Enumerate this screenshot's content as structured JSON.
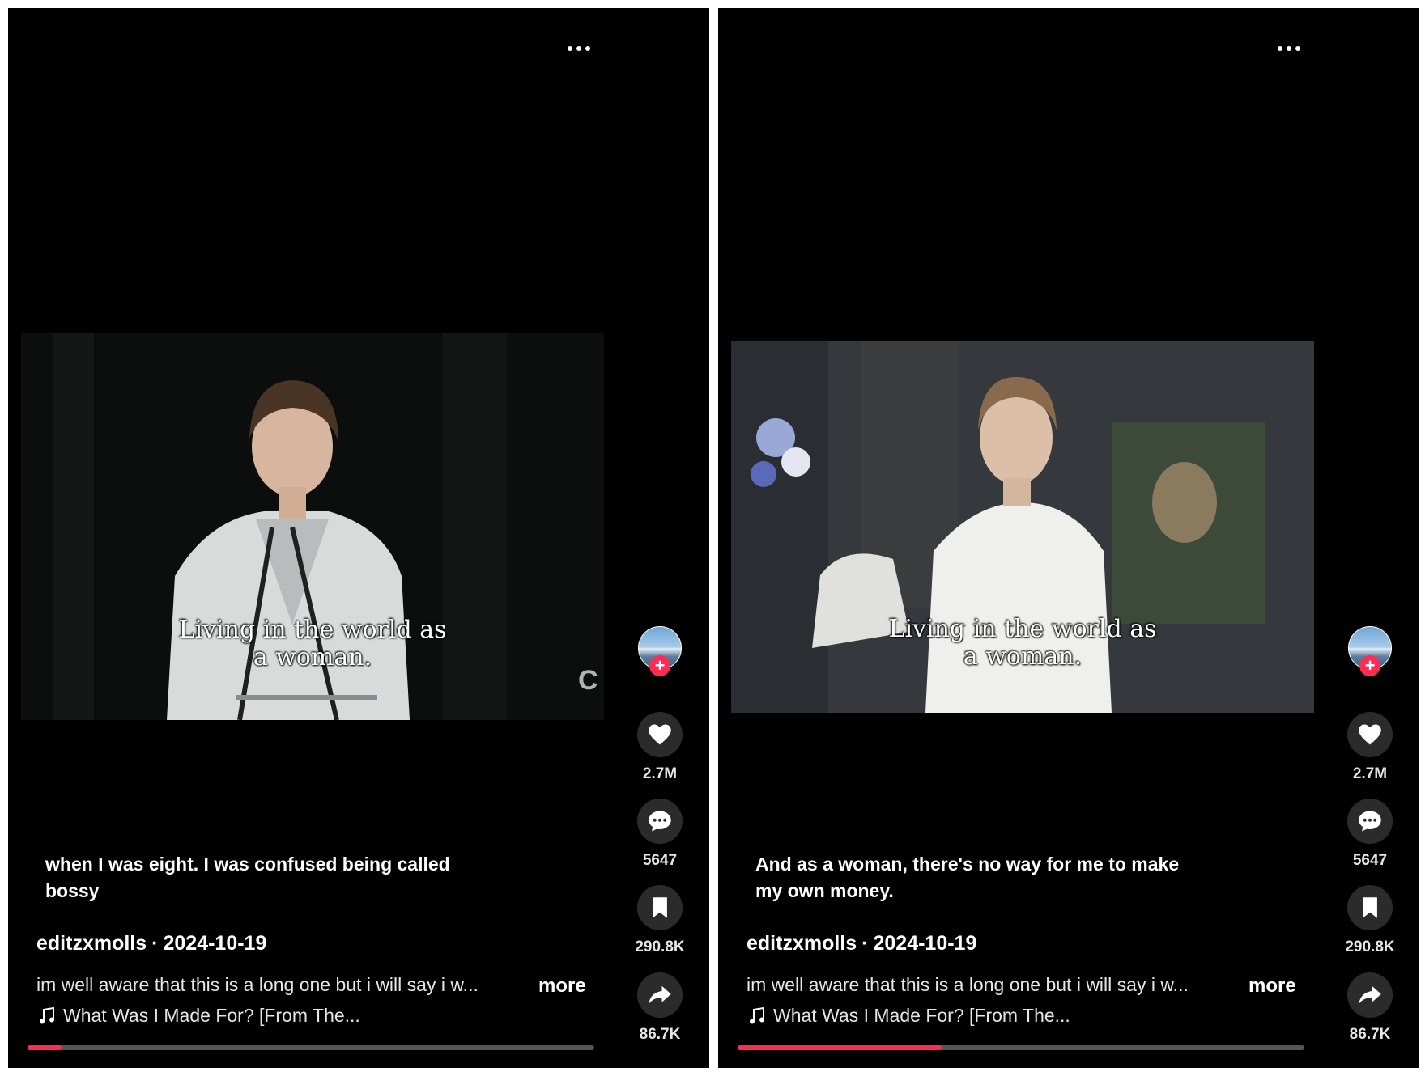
{
  "panels": [
    {
      "subtitle_line1": "Living in the world as",
      "subtitle_line2": "a woman.",
      "watermark": "C",
      "caption": "when I was eight. I was confused being called bossy",
      "username": "editzxmolls",
      "separator": "·",
      "date": "2024-10-19",
      "description": "im well aware that this is a long one but i will say i w...",
      "more_label": "more",
      "music": "What Was I Made For? [From The...",
      "likes": "2.7M",
      "comments": "5647",
      "saves": "290.8K",
      "shares": "86.7K",
      "progress": 0.06
    },
    {
      "subtitle_line1": "Living in the world as",
      "subtitle_line2": "a woman.",
      "caption": "And as a woman, there's no way for me to make my own money.",
      "username": "editzxmolls",
      "separator": "·",
      "date": "2024-10-19",
      "description": "im well aware that this is a long one but i will say i w...",
      "more_label": "more",
      "music": "What Was I Made For? [From The...",
      "likes": "2.7M",
      "comments": "5647",
      "saves": "290.8K",
      "shares": "86.7K",
      "progress": 0.36
    }
  ],
  "icons": {
    "more": "more-horizontal-icon",
    "like": "heart-icon",
    "comment": "comment-icon",
    "save": "bookmark-icon",
    "share": "share-icon",
    "music": "music-note-icon",
    "follow": "plus-icon"
  },
  "colors": {
    "background": "#000000",
    "accent": "#fe2c55",
    "button_bg": "#2b2b2b"
  }
}
